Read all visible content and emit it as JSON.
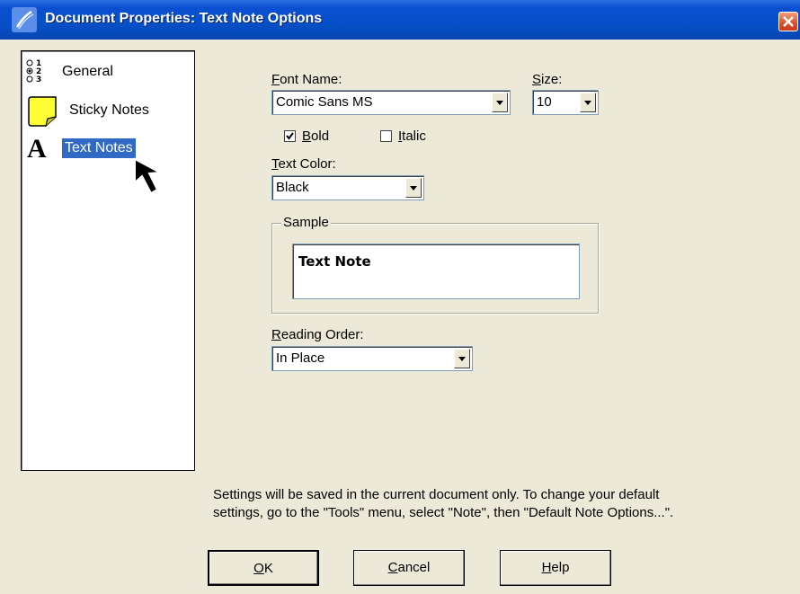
{
  "window": {
    "title": "Document Properties: Text Note Options",
    "icon": "app-icon",
    "close_icon": "close-icon"
  },
  "sidebar": {
    "items": [
      {
        "label": "General",
        "icon": "numbered-list-icon"
      },
      {
        "label": "Sticky Notes",
        "icon": "sticky-note-icon"
      },
      {
        "label": "Text Notes",
        "icon": "text-a-icon",
        "selected": true
      }
    ]
  },
  "font": {
    "name_label_u": "F",
    "name_label_rest": "ont Name:",
    "name_value": "Comic Sans MS",
    "size_label_u": "S",
    "size_label_rest": "ize:",
    "size_value": "10"
  },
  "style": {
    "bold_u": "B",
    "bold_rest": "old",
    "bold_checked": true,
    "italic_u": "I",
    "italic_rest": "talic",
    "italic_checked": false
  },
  "color": {
    "label_u": "T",
    "label_rest": "ext Color:",
    "value": "Black"
  },
  "sample": {
    "legend": "Sample",
    "text": "Text Note"
  },
  "reading": {
    "label_u": "R",
    "label_rest": "eading Order:",
    "value": "In Place"
  },
  "note": {
    "line1": "Settings will be saved in the current document only.  To change your default",
    "line2": "settings, go to the \"Tools\" menu, select \"Note\", then \"Default Note Options...\"."
  },
  "buttons": {
    "ok_u": "O",
    "ok_rest": "K",
    "cancel_u": "C",
    "cancel_rest": "ancel",
    "help_u": "H",
    "help_rest": "elp"
  }
}
